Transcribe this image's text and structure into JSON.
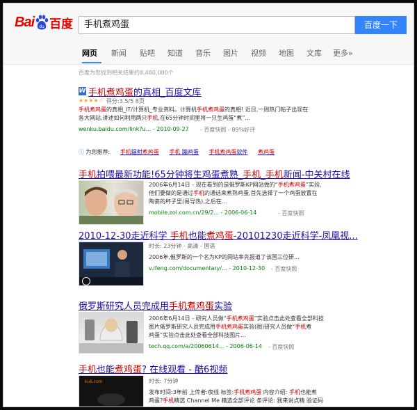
{
  "brand": {
    "logo_text_left": "Bai",
    "logo_text_right": "百度"
  },
  "search": {
    "query": "手机煮鸡蛋",
    "button": "百度一下"
  },
  "tabs": [
    "网页",
    "新闻",
    "贴吧",
    "知道",
    "音乐",
    "图片",
    "视频",
    "地图",
    "文库",
    "更多»"
  ],
  "result_count": "百度为您找到相关结果约8,480,000个",
  "results": [
    {
      "title": "手机煮鸡蛋的真相_百度文库",
      "rating": "评分:3.5/5 8页",
      "desc1": "手机煮鸡蛋的真相_IT/计算机_专业资料。计算机手机煮鸡蛋的真相! 近日,一则热门帖子出现在",
      "desc2": "各大网站,讲述如何利用两只手机,在65分钟时间里将一只生鸡蛋“煮”...",
      "url": "wenku.baidu.com/link?u... - 2010-09-27",
      "meta": "- 百度快照 - 89%好评"
    },
    {
      "title": "手机拍喂最新功能!65分钟将生鸡蛋煮熟_手机_手机新闻-中关村在线",
      "desc1": "2006年6月14日 - 现在看到的是俄罗斯KP网站做的“手机煮鸡蛋”实验,",
      "desc2": "他们要做的是通过手机的通话来煮熟鸡蛋,首先选择了一个鸡蛋放置在",
      "desc3": "陶瓷的杯子里(易导热),之后在...",
      "url": "mobile.zol.com.cn/29/2... - 2006-06-14",
      "meta": "- 百度快照"
    },
    {
      "title": "2010-12-30走近科学 手机也能煮鸡蛋-20101230走近科学-凤凰视...",
      "desc1": "时长: 23分钟 - 高清 - 国语",
      "desc2": "2006年,俄罗斯的一个名为KP的网站率先报道了该国三位研...",
      "url": "v.ifeng.com/documentary/... - 2010-12-30",
      "meta": "- 百度快照"
    },
    {
      "title": "俄罗斯研究人员完成用手机煮鸡蛋实验",
      "desc1": "2006年6月14日 - 研究人员做“手机煮鸡蛋”实验点击此处查看全部科技",
      "desc2": "图片俄罗斯研究人员完成用手机煮鸡蛋实验(图)研究人员做“手机煮",
      "desc3": "鸡蛋”实验点击此处查看全部科技图片...",
      "url": "tech.qq.com/a/20060614... - 2006-06-14",
      "meta": "- 百度快照"
    },
    {
      "title": "手机也能煮鸡蛋? 在线观看 - 酷6视频",
      "desc1": "时长: 7分钟",
      "desc2": "发布时间:3年前 上传者:夜线 标签:手机煮鸡蛋 内容介绍: 手机也能煮",
      "desc3": "鸡蛋?手机精选 Channel Me 精选全部评论 条评论: 我来说点精 验证码"
    }
  ],
  "recommendations": {
    "label": "为您推荐:",
    "items": [
      "手机辐射煮鸡蛋",
      "手机 蹦鸡蛋",
      "手机煮鸡蛋软件",
      "煮鸡蛋"
    ]
  },
  "colors": {
    "accent": "#3385ff",
    "link": "#1a0dab",
    "url": "#008000",
    "highlight": "#cc0000",
    "brand": "#e10602"
  }
}
